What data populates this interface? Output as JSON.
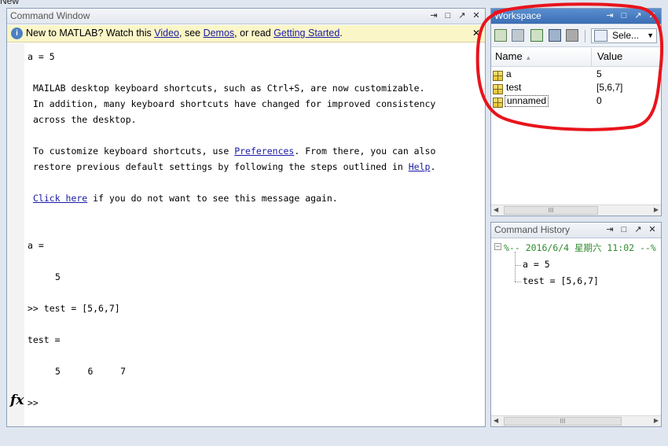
{
  "top_menu": {
    "label": "New"
  },
  "command_window": {
    "title": "Command Window",
    "info_bar": {
      "prefix": "New to MATLAB? Watch this ",
      "video_link": "Video",
      "mid1": ", see ",
      "demos_link": "Demos",
      "mid2": ", or read ",
      "getting_started_link": "Getting Started",
      "suffix": "."
    },
    "lines": {
      "l1": "a = 5",
      "msg1": "MAILAB desktop keyboard shortcuts, such as Ctrl+S, are now customizable.",
      "msg2": "In addition, many keyboard shortcuts have changed for improved consistency",
      "msg3": "across the desktop.",
      "cust_prefix": "To customize keyboard shortcuts, use ",
      "preferences_link": "Preferences",
      "cust_suffix": ". From there, you can also",
      "restore_prefix": "restore previous default settings by following the steps outlined in ",
      "help_link": "Help",
      "restore_suffix": ".",
      "click_here_link": "Click here",
      "click_suffix": " if you do not want to see this message again.",
      "a_eq": "a =",
      "a_val": "5",
      "cmd_test": ">> test = [5,6,7]",
      "test_eq": "test =",
      "test_vals": "5     6     7",
      "prompt": ">>"
    },
    "fx_label": "fx"
  },
  "workspace": {
    "title": "Workspace",
    "select_label": "Sele...",
    "columns": {
      "name": "Name",
      "value": "Value"
    },
    "rows": [
      {
        "name": "a",
        "value": "5"
      },
      {
        "name": "test",
        "value": "[5,6,7]"
      },
      {
        "name": "unnamed",
        "value": "0"
      }
    ],
    "scroll_marker": "III"
  },
  "command_history": {
    "title": "Command History",
    "session": "%-- 2016/6/4 星期六 11:02 --%",
    "entries": [
      "a = 5",
      "test = [5,6,7]"
    ],
    "scroll_marker": "III"
  },
  "colors": {
    "annotation_circle": "#e8141c",
    "history_session": "#2e8b2e"
  }
}
